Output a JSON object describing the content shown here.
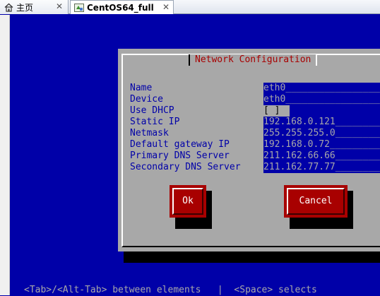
{
  "tabs": [
    {
      "label": "主页",
      "icon": "home-icon",
      "active": false
    },
    {
      "label": "CentOS64_full",
      "icon": "vm-icon",
      "active": true
    }
  ],
  "dialog": {
    "title": "Network Configuration",
    "fields": [
      {
        "label": "Name",
        "value": "eth0_______________________"
      },
      {
        "label": "Device",
        "value": "eth0_______________________"
      },
      {
        "label": "Use DHCP",
        "value": "[ ]"
      },
      {
        "label": "Static IP",
        "value": "192.168.0.121______________"
      },
      {
        "label": "Netmask",
        "value": "255.255.255.0______________"
      },
      {
        "label": "Default gateway IP",
        "value": "192.168.0.72_______________"
      },
      {
        "label": "Primary DNS Server",
        "value": "211.162.66.66______________"
      },
      {
        "label": "Secondary DNS Server",
        "value": "211.162.77.77______________"
      }
    ],
    "ok_label": "Ok",
    "cancel_label": "Cancel"
  },
  "helpline": "<Tab>/<Alt-Tab> between elements   |  <Space> selects",
  "colors": {
    "screen_bg": "#0000a8",
    "dialog_bg": "#a8a8a8",
    "title_text": "#a80000",
    "button_bg": "#a80000"
  }
}
